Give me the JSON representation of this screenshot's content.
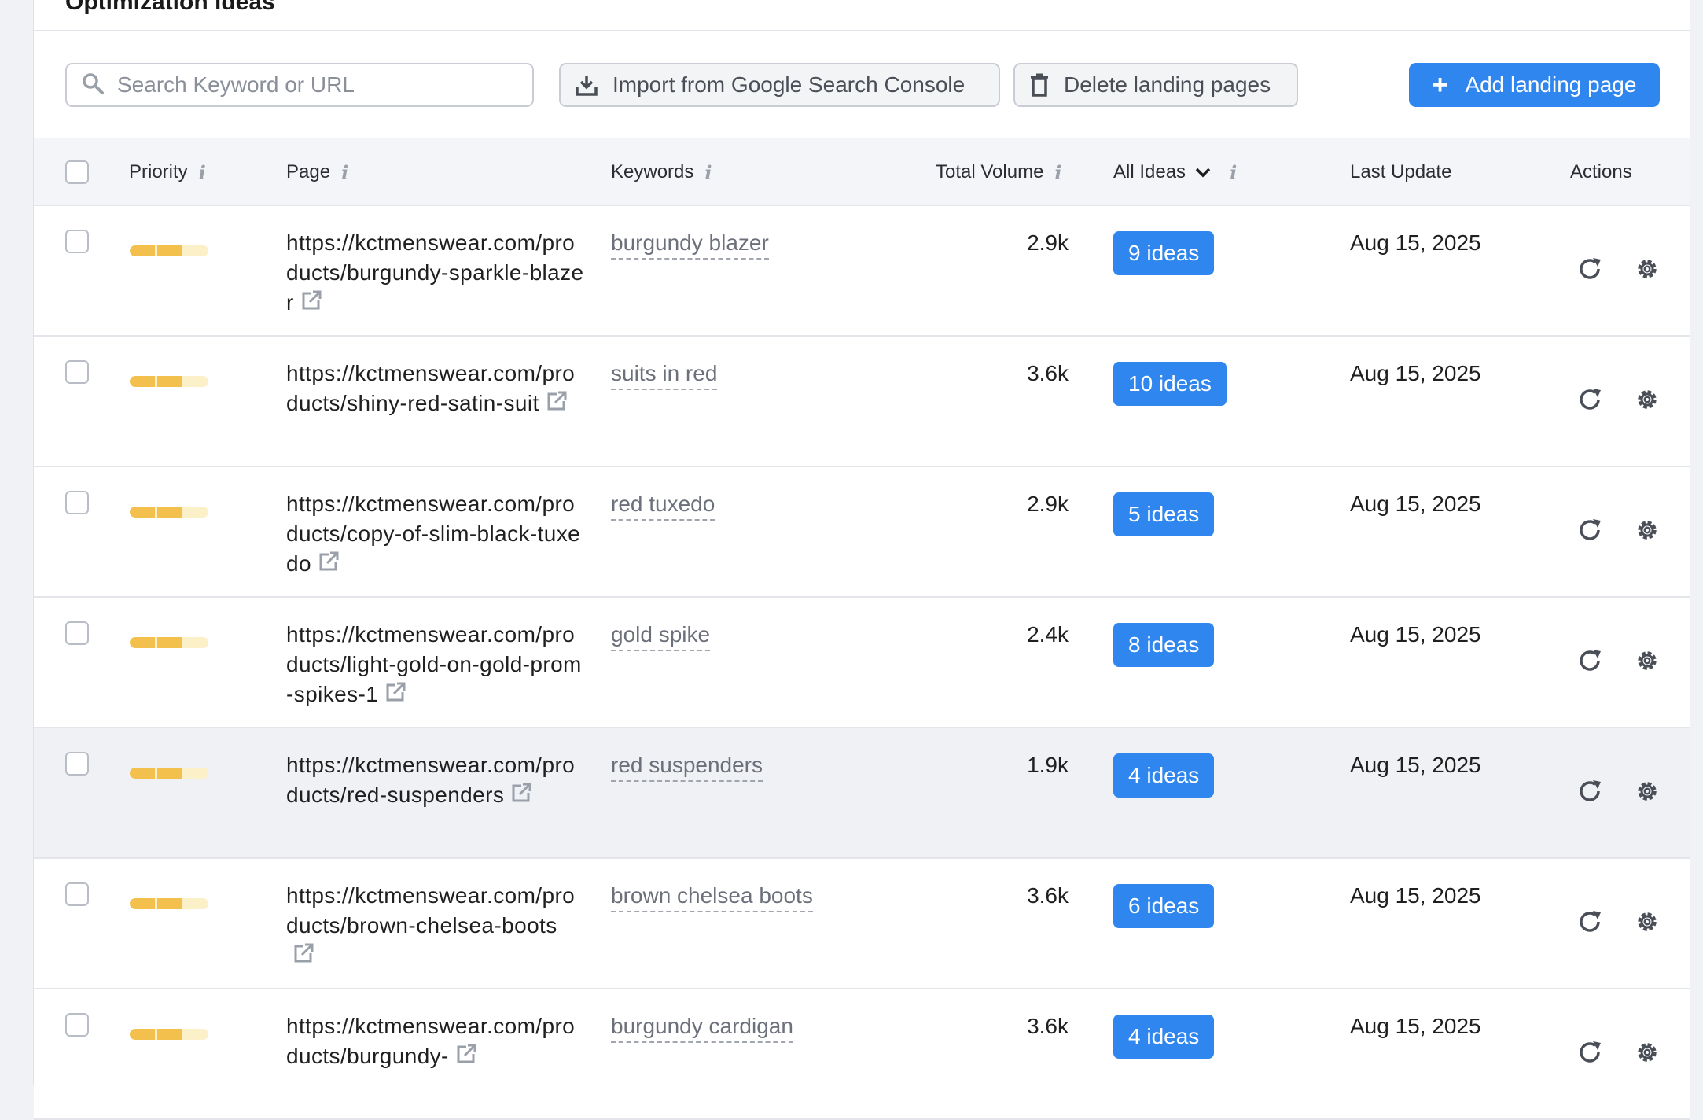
{
  "section_title": "Optimization ideas",
  "toolbar": {
    "search_placeholder": "Search Keyword or URL",
    "import_label": "Import from Google Search Console",
    "delete_label": "Delete landing pages",
    "add_label": "Add landing page"
  },
  "table": {
    "headers": {
      "priority": "Priority",
      "page": "Page",
      "keywords": "Keywords",
      "total_volume": "Total Volume",
      "ideas_filter": "All Ideas",
      "last_update": "Last Update",
      "actions": "Actions"
    },
    "rows": [
      {
        "url": "https://kctmenswear.com/products/burgundy-sparkle-blazer",
        "keyword": "burgundy blazer",
        "volume": "2.9k",
        "ideas": "9 ideas",
        "date": "Aug 15, 2025"
      },
      {
        "url": "https://kctmenswear.com/products/shiny-red-satin-suit",
        "keyword": "suits in red",
        "volume": "3.6k",
        "ideas": "10 ideas",
        "date": "Aug 15, 2025"
      },
      {
        "url": "https://kctmenswear.com/products/copy-of-slim-black-tuxedo",
        "keyword": "red tuxedo",
        "volume": "2.9k",
        "ideas": "5 ideas",
        "date": "Aug 15, 2025"
      },
      {
        "url": "https://kctmenswear.com/products/light-gold-on-gold-prom-spikes-1",
        "keyword": "gold spike",
        "volume": "2.4k",
        "ideas": "8 ideas",
        "date": "Aug 15, 2025"
      },
      {
        "url": "https://kctmenswear.com/products/red-suspenders",
        "keyword": "red suspenders",
        "volume": "1.9k",
        "ideas": "4 ideas",
        "date": "Aug 15, 2025"
      },
      {
        "url": "https://kctmenswear.com/products/brown-chelsea-boots",
        "keyword": "brown chelsea boots",
        "volume": "3.6k",
        "ideas": "6 ideas",
        "date": "Aug 15, 2025"
      },
      {
        "url": "https://kctmenswear.com/products/burgundy-",
        "keyword": "burgundy cardigan",
        "volume": "3.6k",
        "ideas": "4 ideas",
        "date": "Aug 15, 2025"
      }
    ]
  },
  "icons": {
    "search": "search-icon",
    "import": "download-icon",
    "delete": "trash-icon",
    "add": "plus-icon",
    "external": "external-link-icon",
    "refresh": "refresh-icon",
    "settings": "gear-icon"
  },
  "colors": {
    "accent": "#2f86ef",
    "priority_fill": "#f3c04d",
    "priority_track": "#fbf0c7",
    "row_hover": "#f0f1f5"
  }
}
